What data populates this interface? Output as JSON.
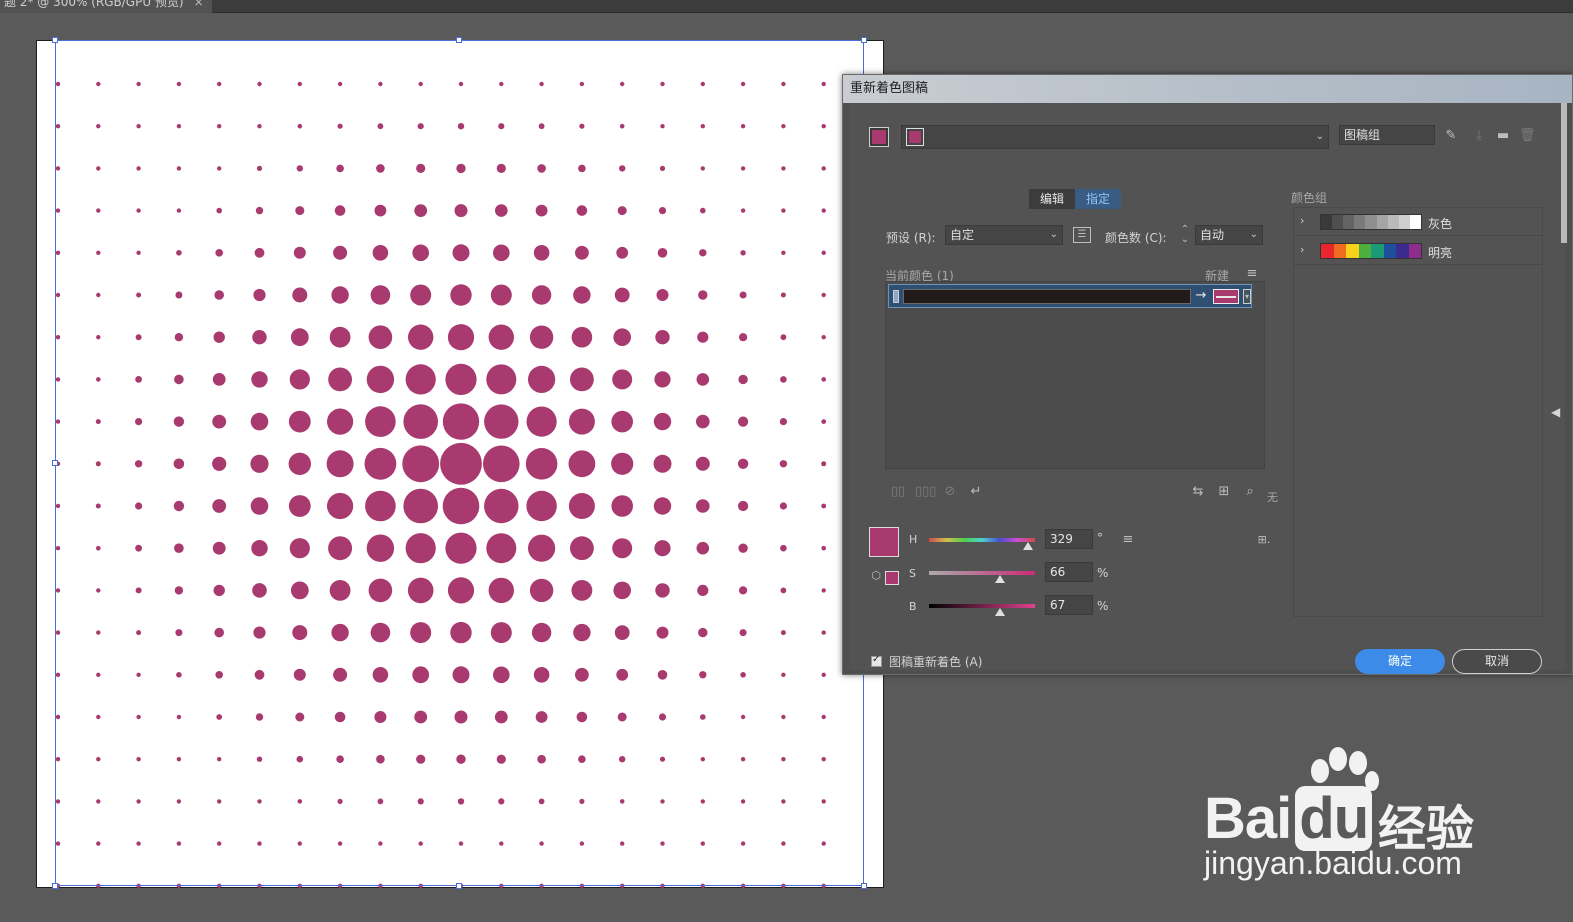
{
  "document": {
    "tab_title": "题 2* @ 300% (RGB/GPU 预览)",
    "close_glyph": "×"
  },
  "artwork": {
    "dot_color": "#a83a6f",
    "pattern": "radial halftone dots"
  },
  "dialog": {
    "title": "重新着色图稿",
    "artwork_group_field": "图稿组",
    "tabs": [
      {
        "label": "编辑",
        "active": false
      },
      {
        "label": "指定",
        "active": true
      }
    ],
    "preset_label": "预设 (R):",
    "preset_value": "自定",
    "colors_label": "颜色数 (C):",
    "colors_value": "自动",
    "current_colors_label": "当前颜色 (1)",
    "new_label": "新建",
    "none_label": "无",
    "hsb": {
      "h_label": "H",
      "h_value": "329",
      "h_unit": "°",
      "s_label": "S",
      "s_value": "66",
      "s_unit": "%",
      "b_label": "B",
      "b_value": "67",
      "b_unit": "%"
    },
    "color_groups_label": "颜色组",
    "color_groups": [
      {
        "name": "灰色",
        "colors": [
          "#3a3a3a",
          "#4f4f4f",
          "#646464",
          "#7a7a7a",
          "#8f8f8f",
          "#a5a5a5",
          "#bababa",
          "#d0d0d0",
          "#ffffff"
        ]
      },
      {
        "name": "明亮",
        "colors": [
          "#e8262b",
          "#f06b22",
          "#f6d21b",
          "#4caf3e",
          "#1a9a75",
          "#1f4f9c",
          "#3b2a8f",
          "#8f2d8c"
        ]
      }
    ],
    "recolor_checkbox_label": "图稿重新着色 (A)",
    "recolor_checked": true,
    "ok_label": "确定",
    "cancel_label": "取消",
    "accent_color": "#a83a6f"
  },
  "watermark": {
    "logo_text": "Bai",
    "logo_text2": "du",
    "cn_text": "经验",
    "url": "jingyan.baidu.com"
  }
}
